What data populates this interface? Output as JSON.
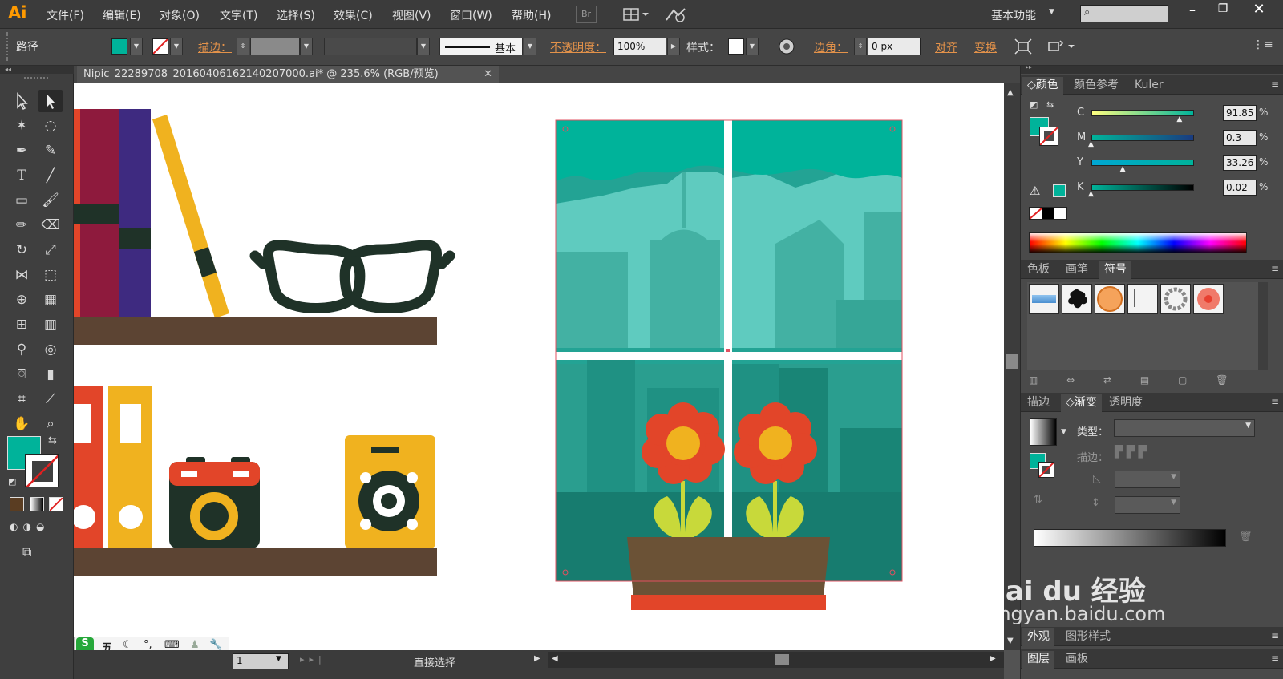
{
  "app": {
    "logo": "Ai"
  },
  "menu": [
    "文件(F)",
    "编辑(E)",
    "对象(O)",
    "文字(T)",
    "选择(S)",
    "效果(C)",
    "视图(V)",
    "窗口(W)",
    "帮助(H)"
  ],
  "menubar": {
    "bridge": "Br",
    "workspace": "基本功能",
    "search_placeholder": ""
  },
  "control": {
    "selection_type": "路径",
    "stroke_label": "描边：",
    "stroke_profile": "基本",
    "opacity_label": "不透明度：",
    "opacity_value": "100%",
    "style_label": "样式：",
    "corner_label": "边角：",
    "corner_value": "0 px",
    "align": "对齐",
    "transform": "变换"
  },
  "document": {
    "tab_title": "Nipic_22289708_20160406162140207000.ai* @ 235.6% (RGB/预览)"
  },
  "status": {
    "page": "1",
    "tool": "直接选择"
  },
  "panels": {
    "color_tabs": [
      "颜色",
      "颜色参考",
      "Kuler"
    ],
    "cmyk": [
      {
        "label": "C",
        "value": "91.85",
        "pos": 0.92
      },
      {
        "label": "M",
        "value": "0.3",
        "pos": 0.0
      },
      {
        "label": "Y",
        "value": "33.26",
        "pos": 0.33
      },
      {
        "label": "K",
        "value": "0.02",
        "pos": 0.0
      }
    ],
    "pct": "%",
    "swatch_tabs": [
      "色板",
      "画笔",
      "符号"
    ],
    "stroke_tabs": [
      "描边",
      "渐变",
      "透明度"
    ],
    "gradient": {
      "type_label": "类型：",
      "stroke_label": "描边："
    },
    "appearance_tabs": [
      "外观",
      "图形样式"
    ],
    "layers_tabs": [
      "图层",
      "画板"
    ]
  },
  "ime": {
    "brand": "S",
    "mode": "五"
  },
  "watermark": {
    "logo": "Bai du 经验",
    "url": "jingyan.baidu.com"
  },
  "colors": {
    "fill": "#00b39a",
    "accent": "#ff9a00"
  }
}
